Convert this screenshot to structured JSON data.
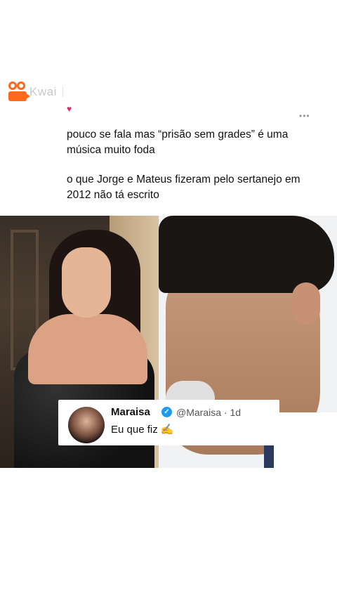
{
  "header": {
    "logo_text": "Kwai"
  },
  "icons": {
    "heart": "♥",
    "more": "•••",
    "verified": "✓"
  },
  "tweet": {
    "line1": "pouco se fala mas “prisão sem grades” é uma música muito foda",
    "line2": "o que Jorge e Mateus fizeram pelo sertanejo em 2012 não tá escrito"
  },
  "reply": {
    "name": "Maraisa",
    "handle": "@Maraisa · 1d",
    "text": "Eu que fiz ✍️"
  },
  "colors": {
    "brand": "#ff6a1a",
    "heart": "#e0245e",
    "verified": "#1d9bf0"
  }
}
